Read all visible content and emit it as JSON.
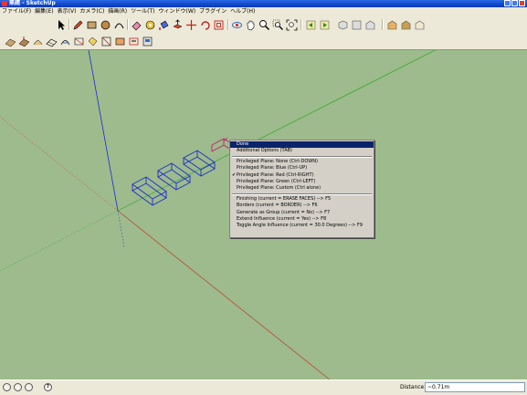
{
  "window": {
    "title": "無題 - SketchUp"
  },
  "menubar": {
    "items": [
      "ファイル(F)",
      "編集(E)",
      "表示(V)",
      "カメラ(C)",
      "描画(R)",
      "ツール(T)",
      "ウィンドウ(W)",
      "プラグイン",
      "ヘルプ(H)"
    ]
  },
  "context_menu": {
    "done": "Done",
    "additional_options": "Additional Options (TAB)",
    "plane_none": "Privileged Plane: None (Ctrl-DOWN)",
    "plane_blue": "Privileged Plane: Blue (Ctrl-UP)",
    "plane_red": "Privileged Plane: Red (Ctrl-RIGHT)",
    "plane_red_check": "✔",
    "plane_green": "Privileged Plane: Green (Ctrl-LEFT)",
    "plane_custom": "Privileged Plane: Custom (Ctrl alone)",
    "finishing": "Finishing (current = ERASE FACES) --> F5",
    "borders": "Borders (current = BORDER) --> F6",
    "generate_group": "Generate as Group (current = No) --> F7",
    "extend_influence": "Extend Influence (current = Yes) --> F8",
    "toggle_angle": "Toggle Angle Influence (current = 30.0 Degrees) --> F9"
  },
  "statusbar": {
    "help_icon_glyph": "?",
    "distance_label": "Distance",
    "distance_value": "~0.71m"
  },
  "colors": {
    "viewport_bg": "#9dbb8c",
    "axis_blue": "#1f28d6",
    "axis_red": "#c03a2a",
    "axis_green": "#2ea82a",
    "menu_highlight": "#0a246a",
    "box_edge": "#1f2ad0",
    "preview_edge": "#c02070"
  }
}
